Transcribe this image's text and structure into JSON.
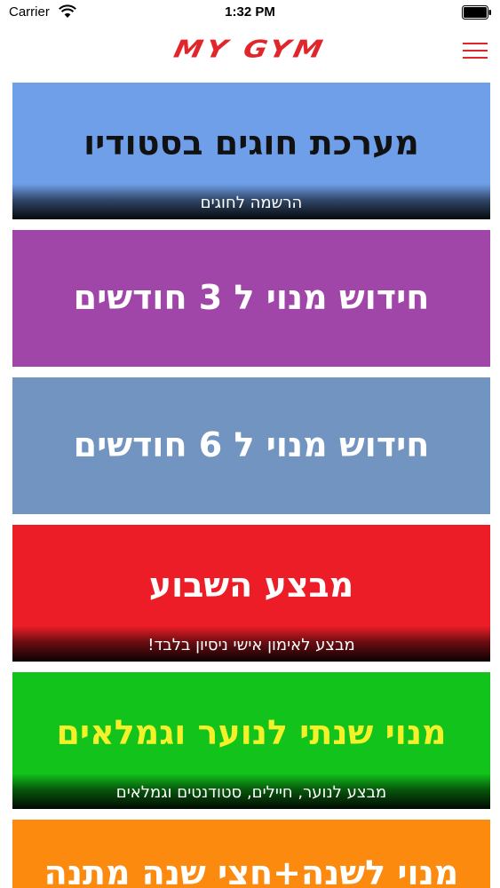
{
  "status_bar": {
    "carrier": "Carrier",
    "time": "1:32 PM"
  },
  "header": {
    "logo_text": "MY GYM",
    "menu_icon": "hamburger-menu-icon",
    "accent_color": "#e0262b"
  },
  "cards": [
    {
      "title": "מערכת חוגים בסטודיו",
      "subtitle": "הרשמה לחוגים",
      "background": "#6e9fe8",
      "title_color": "#111111"
    },
    {
      "title": "חידוש מנוי ל 3 חודשים",
      "subtitle": "",
      "background": "#a046a8",
      "title_color": "#ffffff"
    },
    {
      "title": "חידוש מנוי ל 6 חודשים",
      "subtitle": "",
      "background": "#7194c0",
      "title_color": "#ffffff"
    },
    {
      "title": "מבצע השבוע",
      "subtitle": "מבצע לאימון אישי ניסיון בלבד!",
      "background": "#ec1d26",
      "title_color": "#ffffff"
    },
    {
      "title": "מנוי שנתי לנוער וגמלאים",
      "subtitle": "מבצע לנוער, חיילים, סטודנטים וגמלאים",
      "background": "#11c31b",
      "title_color": "#f4f12a"
    },
    {
      "title": "מנוי לשנה+חצי שנה מתנה",
      "subtitle": "",
      "background": "#fb8a0f",
      "title_color": "#ffffff"
    }
  ]
}
